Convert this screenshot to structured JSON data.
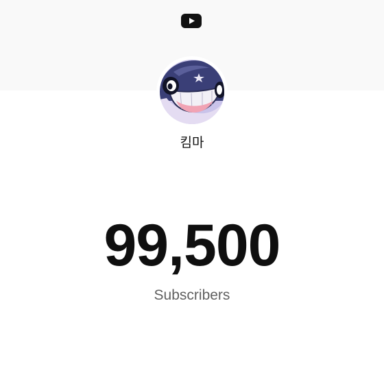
{
  "app": {
    "logo_icon": "youtube-play-icon"
  },
  "channel": {
    "name": "킴마",
    "avatar_icon": "cartoon-character-avatar"
  },
  "stats": {
    "subscriber_count": "99,500",
    "subscriber_label": "Subscribers"
  },
  "colors": {
    "banner": "#f9f9f9",
    "count": "#0f0f0f",
    "label": "#606060"
  }
}
